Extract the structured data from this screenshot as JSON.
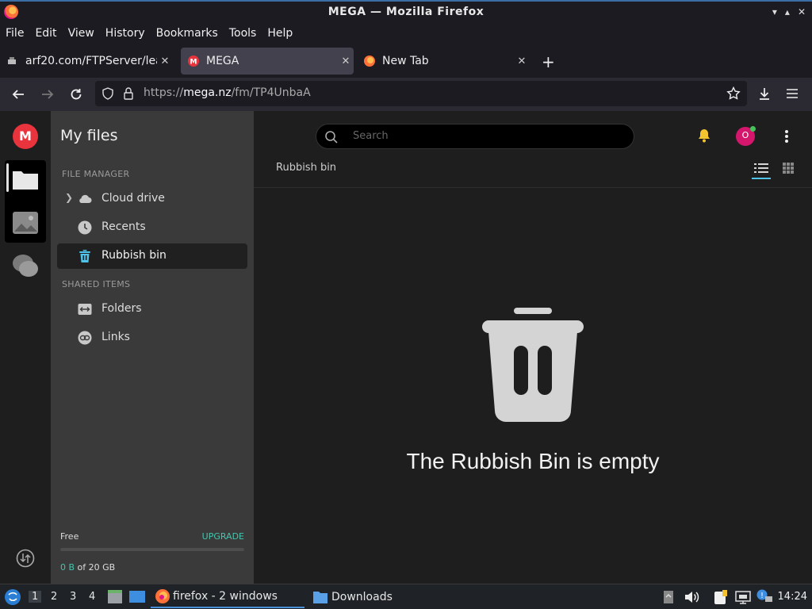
{
  "window": {
    "title": "MEGA — Mozilla Firefox"
  },
  "menu": [
    "File",
    "Edit",
    "View",
    "History",
    "Bookmarks",
    "Tools",
    "Help"
  ],
  "tabs": [
    {
      "label": "arf20.com/FTPServer/lea",
      "active": false
    },
    {
      "label": "MEGA",
      "active": true
    },
    {
      "label": "New Tab",
      "active": false
    }
  ],
  "urlbar": {
    "prefix": "https://",
    "domain": "mega.nz",
    "path": "/fm/TP4UnbaA"
  },
  "sidebar": {
    "title": "My files",
    "file_manager_heading": "FILE MANAGER",
    "items": [
      {
        "label": "Cloud drive",
        "icon": "cloud-icon"
      },
      {
        "label": "Recents",
        "icon": "clock-icon"
      },
      {
        "label": "Rubbish bin",
        "icon": "trash-icon",
        "active": true
      }
    ],
    "shared_heading": "SHARED ITEMS",
    "shared_items": [
      {
        "label": "Folders",
        "icon": "shared-folder-icon"
      },
      {
        "label": "Links",
        "icon": "link-icon"
      }
    ],
    "storage": {
      "plan": "Free",
      "upgrade": "UPGRADE",
      "used": "0 B",
      "total": "of 20 GB",
      "used_fraction": 0
    }
  },
  "main": {
    "search_placeholder": "Search",
    "breadcrumb": "Rubbish bin",
    "empty_message": "The Rubbish Bin is empty",
    "avatar_letter": "O"
  },
  "taskbar": {
    "workspaces": [
      "1",
      "2",
      "3",
      "4"
    ],
    "tasks": [
      {
        "label": "firefox - 2 windows",
        "active": true
      },
      {
        "label": "Downloads",
        "active": false
      }
    ],
    "clock": "14:24"
  },
  "colors": {
    "mega_red": "#e9343e",
    "accent_teal": "#47c3ab",
    "active_blue": "#4a90d9",
    "avatar_pink": "#d4176c"
  }
}
